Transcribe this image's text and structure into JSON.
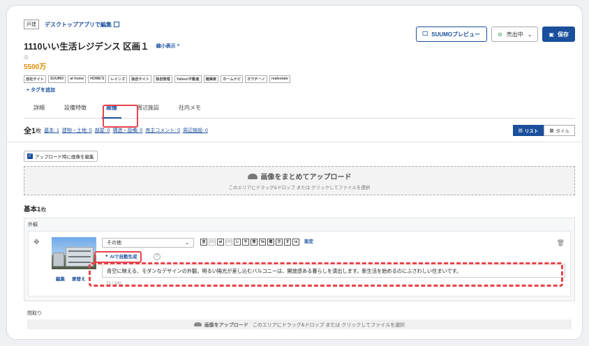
{
  "header": {
    "type_badge": "戸建",
    "edit_link": "デスクトップアプリで編集",
    "suumo_preview": "SUUMOプレビュー",
    "status_select": "売出中",
    "save": "保存"
  },
  "property": {
    "title": "1110いい生活レジデンス 区画１",
    "collapse_link": "縮小表示 ^",
    "price": "5500万"
  },
  "tags": [
    "自社サイト",
    "SUUMO",
    "at home",
    "HOME'S",
    "レインズ",
    "独自サイト",
    "独自管理",
    "Yahoo!不動産",
    "健美家",
    "ホームナビ",
    "オウチーノ",
    "realestate"
  ],
  "add_tag": "+ タグを追加",
  "tabs": [
    {
      "label": "詳細"
    },
    {
      "label": "設備特徴"
    },
    {
      "label": "画像"
    },
    {
      "label": "周辺施設"
    },
    {
      "label": "社内メモ"
    }
  ],
  "summary": {
    "total_label": "全1",
    "unit": "枚",
    "links": [
      "基本: 1",
      "建物・土地: 0",
      "部屋: 0",
      "構造・設備: 0",
      "売主コメント: 0",
      "周辺施設: 0"
    ]
  },
  "view_toggle": {
    "list": "リスト",
    "tile": "タイル"
  },
  "edit_on_upload": "アップロード時に画像を編集",
  "upload": {
    "title": "画像をまとめてアップロード",
    "subtitle": "このエリアにドラッグ&ドロップ または クリックしてファイルを選択"
  },
  "basic_section": {
    "title": "基本",
    "count": "1",
    "unit": "枚"
  },
  "exterior": {
    "heading": "外観",
    "category": "その他",
    "media_labels": [
      "自",
      "SU",
      "at",
      "HO",
      "レ",
      "サ",
      "管",
      "Ya",
      "健",
      "ホ",
      "オ",
      "re"
    ],
    "settings": "設定",
    "edit": "編集",
    "replace": "差替え",
    "ai_generate": "AIで自動生成",
    "help": "?",
    "description": "青空に映える、モダンなデザインの外観。明るい陽光が差し込むバルコニーは、開放感ある暮らしを演出します。新生活を始めるのにふさわしい住まいです。",
    "char_count": "71 / 100"
  },
  "floorplan": {
    "heading": "間取り",
    "upload_title": "画像をアップロード",
    "upload_sub": "このエリアにドラッグ&ドロップ または クリックしてファイルを選択"
  },
  "colors": {
    "primary": "#1a4f9c",
    "accent_price": "#e08a00",
    "highlight": "#e8424a"
  }
}
